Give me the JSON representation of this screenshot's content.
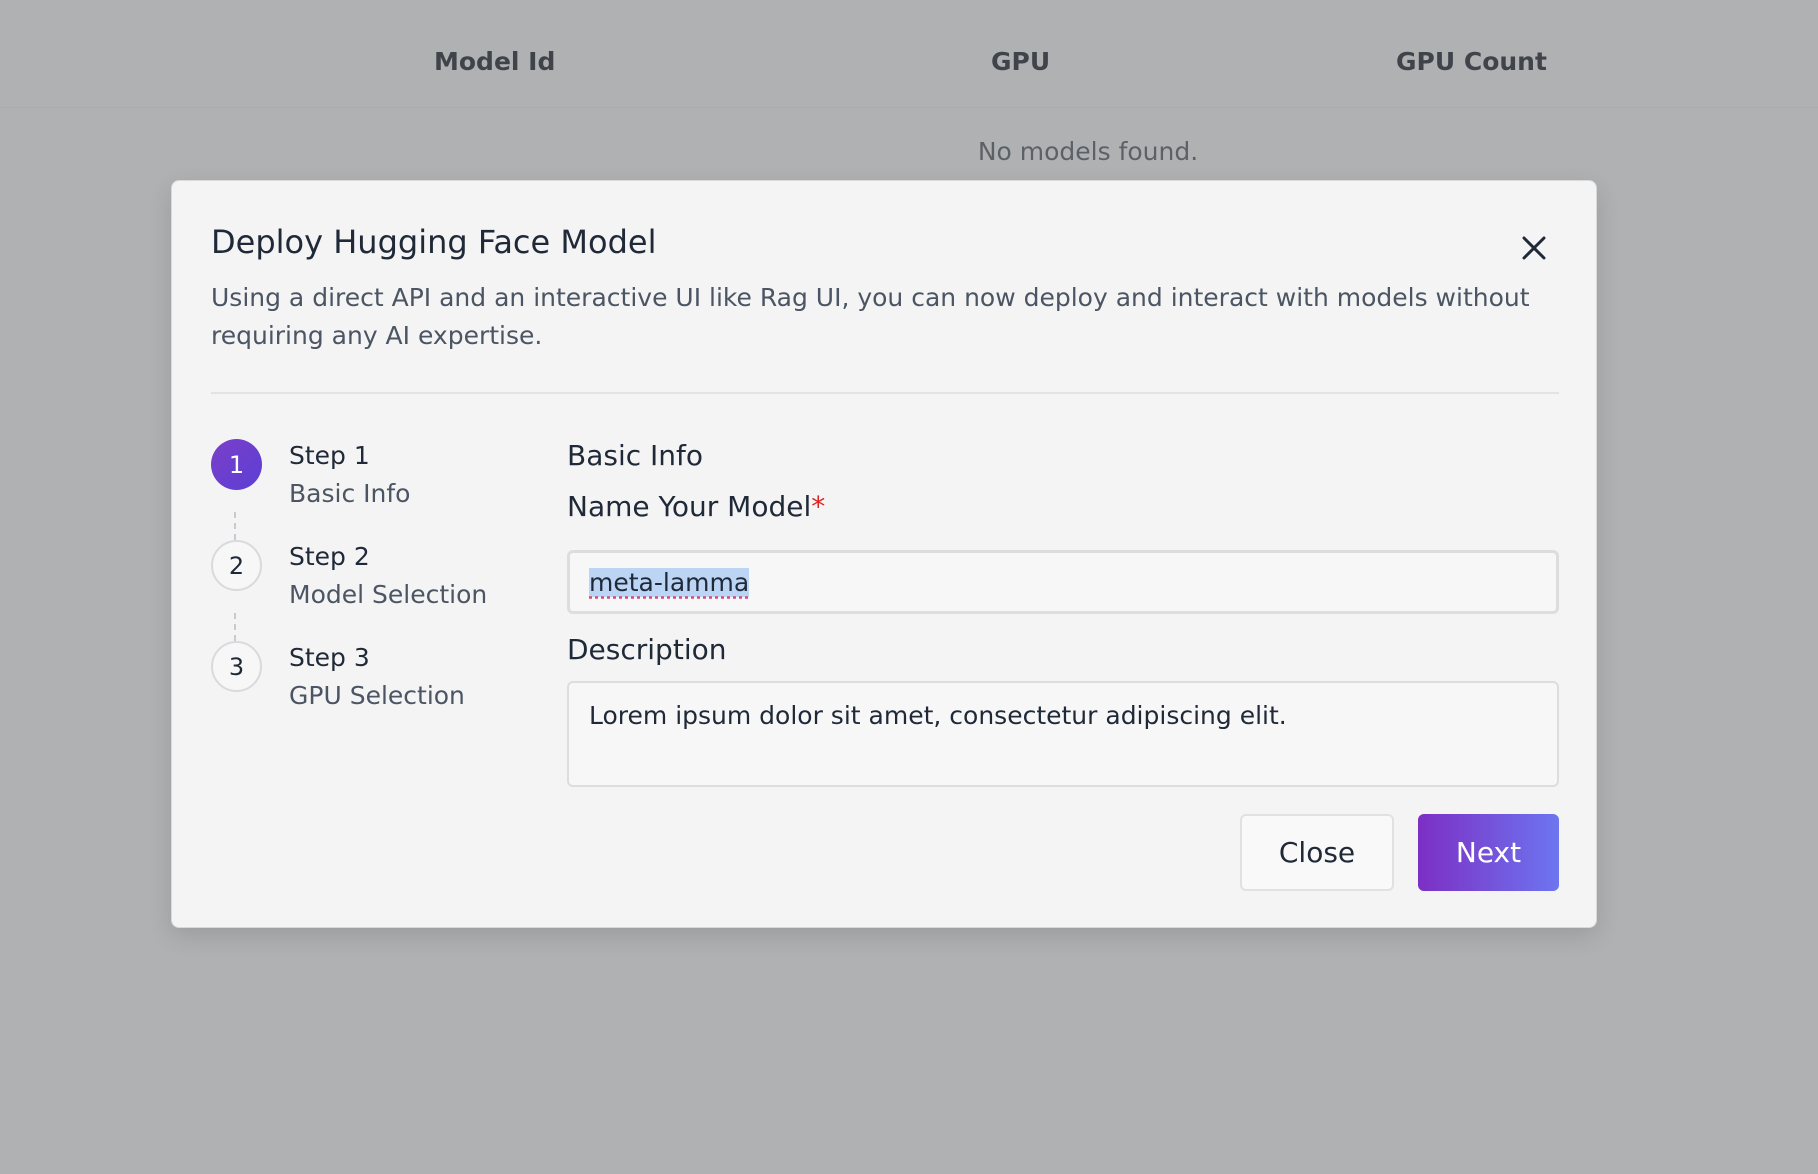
{
  "table": {
    "columns": [
      "Model Id",
      "GPU",
      "GPU Count"
    ],
    "empty_message": "No models found."
  },
  "modal": {
    "title": "Deploy Hugging Face Model",
    "description": "Using a direct API and an interactive UI like Rag UI, you can now deploy and interact with models without requiring any AI expertise.",
    "close_icon": "close-icon",
    "steps": [
      {
        "number": "1",
        "title": "Step 1",
        "subtitle": "Basic Info",
        "active": true
      },
      {
        "number": "2",
        "title": "Step 2",
        "subtitle": "Model Selection",
        "active": false
      },
      {
        "number": "3",
        "title": "Step 3",
        "subtitle": "GPU Selection",
        "active": false
      }
    ],
    "form": {
      "section_title": "Basic Info",
      "name_label": "Name Your Model",
      "name_required_mark": "*",
      "name_value": "meta-lamma",
      "description_label": "Description",
      "description_value": "Lorem ipsum dolor sit amet, consectetur adipiscing elit."
    },
    "buttons": {
      "close_label": "Close",
      "next_label": "Next"
    }
  },
  "colors": {
    "accent_start": "#7c2fc4",
    "accent_end": "#6d75f0",
    "required": "#dc2626"
  }
}
